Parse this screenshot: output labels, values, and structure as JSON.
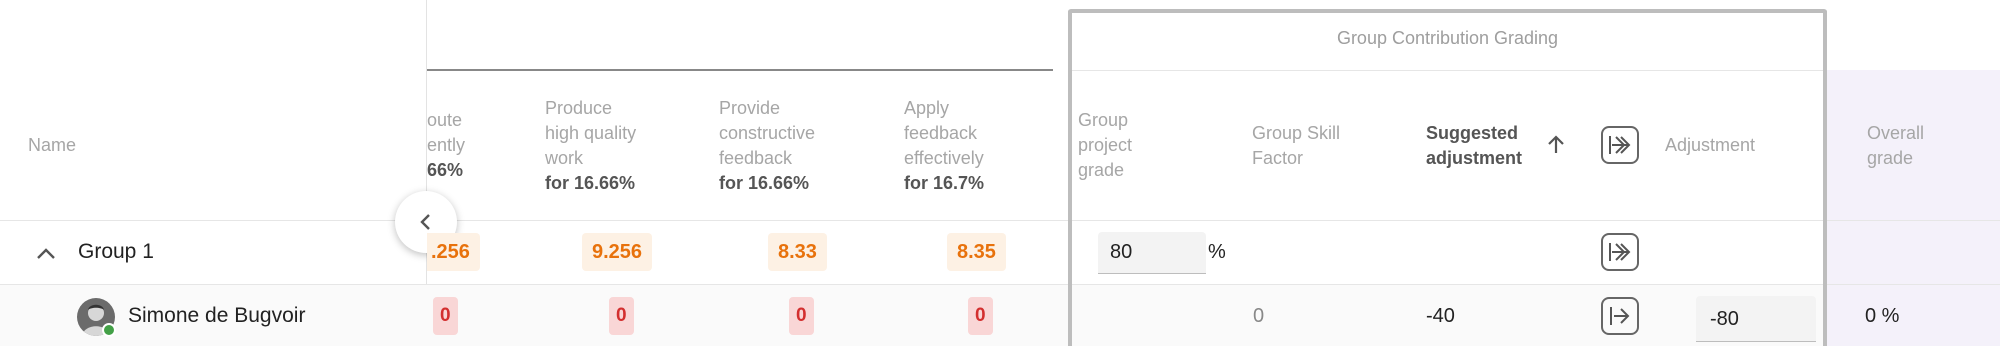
{
  "section_title": "Group Contribution Grading",
  "columns": {
    "name": "Name",
    "c1_partial_l1": "oute",
    "c1_partial_l2": "ently",
    "c1_weight": "66%",
    "c2_l1": "Produce",
    "c2_l2": "high quality",
    "c2_l3": "work",
    "c2_weight": "for 16.66%",
    "c3_l1": "Provide",
    "c3_l2": "constructive",
    "c3_l3": "feedback",
    "c3_weight": "for 16.66%",
    "c4_l1": "Apply",
    "c4_l2": "feedback",
    "c4_l3": "effectively",
    "c4_weight": "for 16.7%",
    "gpg_l1": "Group",
    "gpg_l2": "project",
    "gpg_l3": "grade",
    "gsf_l1": "Group Skill",
    "gsf_l2": "Factor",
    "sa_l1": "Suggested",
    "sa_l2": "adjustment",
    "adjustment": "Adjustment",
    "og_l1": "Overall",
    "og_l2": "grade"
  },
  "group_row": {
    "name": "Group 1",
    "c1": ".256",
    "c2": "9.256",
    "c3": "8.33",
    "c4": "8.35",
    "project_grade": "80",
    "percent_sign": "%"
  },
  "student_row": {
    "name": "Simone de Bugvoir",
    "c1": "0",
    "c2": "0",
    "c3": "0",
    "c4": "0",
    "skill_factor": "0",
    "suggested": "-40",
    "adjustment": "-80",
    "overall": "0 %"
  },
  "colors": {
    "orange": "#e8720c",
    "red": "#d32f2f",
    "overall_bg": "#f3f0fa"
  }
}
